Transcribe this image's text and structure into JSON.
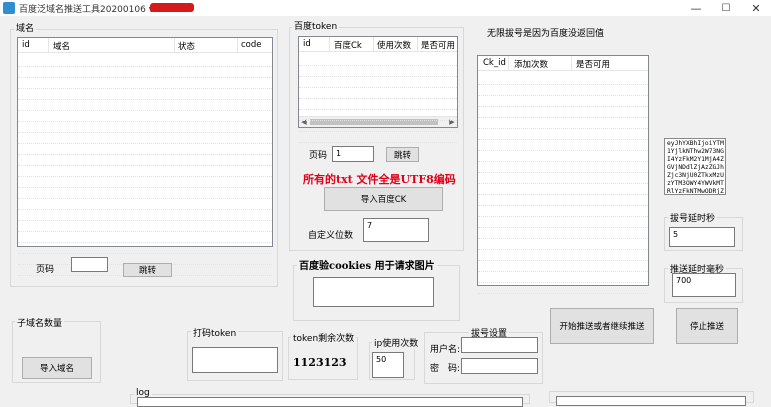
{
  "window": {
    "title": "百度泛域名推送工具20200106 v2.8 BY",
    "minimize_glyph": "—",
    "maximize_glyph": "☐",
    "close_glyph": "✕"
  },
  "domains": {
    "group_label": "域名",
    "columns": [
      "id",
      "域名",
      "状态",
      "code"
    ],
    "page_label": "页码",
    "page_value": "",
    "jump_label": "跳转"
  },
  "token_list": {
    "group_label": "百度token",
    "columns": [
      "id",
      "百度Ck",
      "使用次数",
      "是否可用"
    ],
    "page_label": "页码",
    "page_value": "1",
    "jump_label": "跳转",
    "notice": "所有的txt 文件全是UTF8编码",
    "import_label": "导入百度CK",
    "custom_pos_label": "自定义位数",
    "custom_pos_value": "7"
  },
  "cookies": {
    "group_label": "百度验cookies 用于请求图片",
    "value": ""
  },
  "unlimited": {
    "caption": "无限拔号是因为百度没返回值",
    "columns": [
      "Ck_id",
      "添加次数",
      "是否可用"
    ]
  },
  "token_text": "eyJhYXBhIjoiYTM\n1YjlkNThw2W73NG\nI4YzFkM2Y1MjA4Z\nGVjNDdlZjAzZGJh\nZjc3NjU0ZTkxMzU\nzYTM3OWY4YWVkMT\nRlYzFkNTMwODRjZ",
  "dial_wait": {
    "group_label": "拔号延时秒",
    "value": "5"
  },
  "push_delay": {
    "group_label": "推送延时毫秒",
    "value": "700"
  },
  "subdomain": {
    "group_label": "子域名数量",
    "import_label": "导入域名"
  },
  "captcha": {
    "group_label": "打码token",
    "value": ""
  },
  "token_left": {
    "group_label": "token剩余次数",
    "value": "1123123"
  },
  "ip_usage": {
    "group_label": "ip使用次数",
    "value": "50"
  },
  "dial": {
    "group_label": "拔号设置",
    "user_label": "用户名:",
    "user_value": "",
    "pass_label": "密　码:",
    "pass_value": ""
  },
  "actions": {
    "start_label": "开始推送或者继续推送",
    "stop_label": "停止推送"
  },
  "log": {
    "group_label": "log"
  },
  "colors": {
    "notice_red": "#e0001a",
    "title_redact": "#d41a1a",
    "app_icon": "#2f8fd1"
  }
}
